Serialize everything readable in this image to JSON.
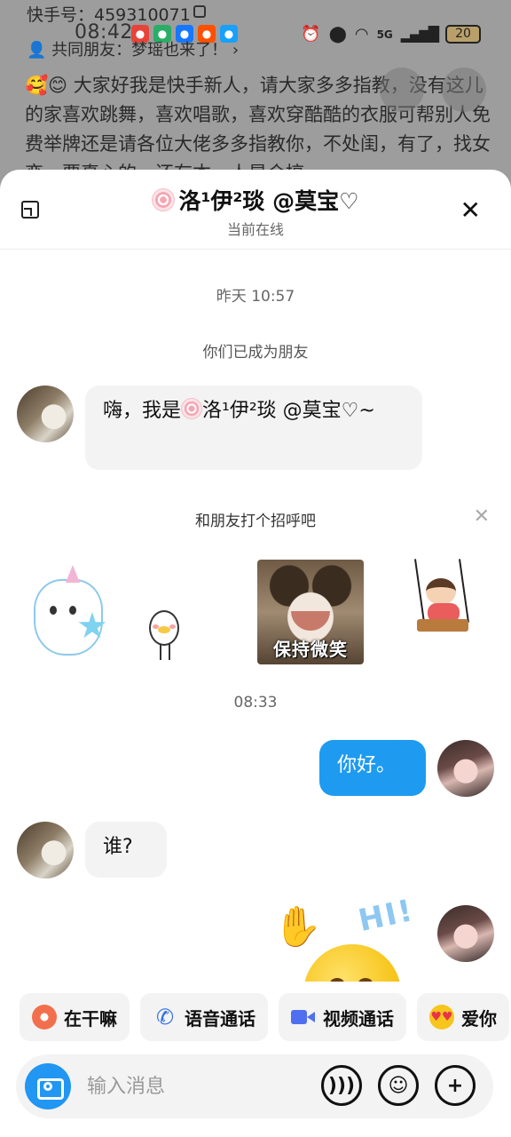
{
  "background_profile": {
    "kuaishou_id": "快手号：459310071",
    "status_time": "08:42",
    "common_friends": "共同朋友：梦瑶也来了！",
    "bio": "🥰😊 大家好我是快手新人，请大家多多指教，没有这儿的家喜欢跳舞，喜欢唱歌，喜欢穿酷酷的衣服可帮别人免费举牌还是请各位大佬多多指教你，不处闺，有了，找女恋，要真心的，还有本一人是合搞",
    "battery": "20",
    "network": "5G"
  },
  "chat": {
    "title": "洛¹伊²琰 @莫宝♡",
    "status": "当前在线"
  },
  "messages": {
    "ts_yesterday": "昨天 10:57",
    "system_friends": "你们已成为朋友",
    "friend_intro_prefix": "嗨，我是",
    "friend_intro_name": "洛¹伊²琰 @莫宝♡~",
    "greet_label": "和朋友打个招呼吧",
    "meme_caption": "保持微笑",
    "ts_today": "08:33",
    "me_hello": "你好。",
    "friend_who": "谁?",
    "hi_sticker_text": "HI!"
  },
  "quick_actions": [
    {
      "label": "在干嘛",
      "icon": "wave-icon"
    },
    {
      "label": "语音通话",
      "icon": "phone-icon"
    },
    {
      "label": "视频通话",
      "icon": "video-icon"
    },
    {
      "label": "爱你",
      "icon": "heart-eyes-icon"
    }
  ],
  "input": {
    "placeholder": "输入消息"
  },
  "colors": {
    "accent_blue": "#1e9bf0",
    "camera_blue": "#2196f3",
    "bubble_gray": "#f3f3f3"
  }
}
